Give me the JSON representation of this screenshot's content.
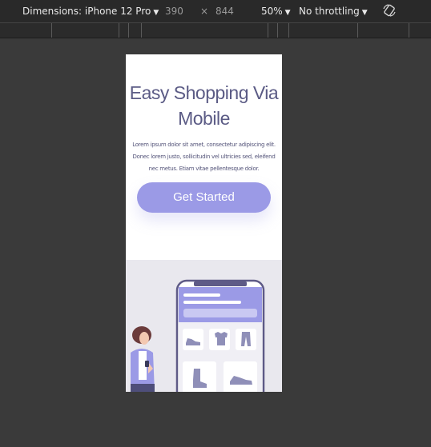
{
  "devtools": {
    "device_label": "Dimensions: iPhone 12 Pro",
    "width_value": "390",
    "times_symbol": "×",
    "height_value": "844",
    "zoom_label": "50%",
    "throttle_label": "No throttling",
    "rotate_icon": "rotate-icon"
  },
  "page": {
    "title": "Easy Shopping Via Mobile",
    "description": "Lorem ipsum dolor sit amet, consectetur adipiscing elit. Donec lorem justo, sollicitudin vel ultricies sed, eleifend nec metus. Etiam vitae pellentesque dolor.",
    "cta_label": "Get Started"
  },
  "colors": {
    "accent": "#9b9ae6",
    "title": "#5b5b85",
    "phone_frame": "#5e5a86",
    "illustration_bg": "#e9e8ee"
  }
}
